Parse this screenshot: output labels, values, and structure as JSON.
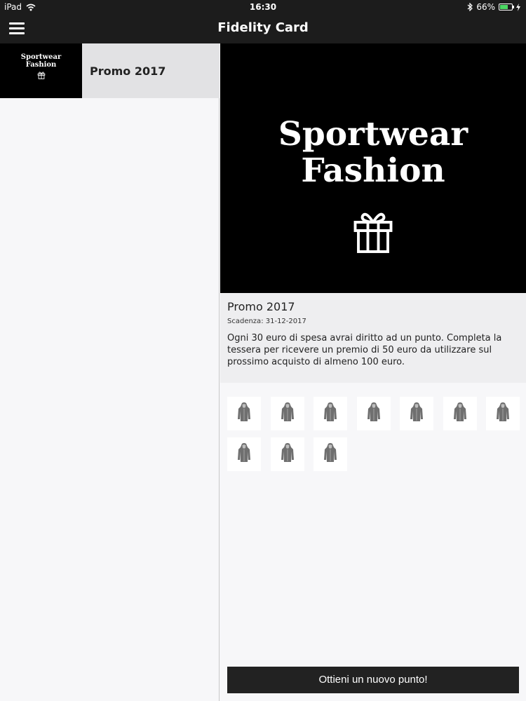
{
  "status_bar": {
    "device": "iPad",
    "time": "16:30",
    "battery_text": "66%",
    "battery_level": 0.66,
    "icons": [
      "wifi-icon",
      "bluetooth-icon",
      "battery-icon",
      "charging-icon"
    ]
  },
  "nav": {
    "title": "Fidelity Card",
    "menu_icon": "hamburger-menu-icon"
  },
  "list": {
    "items": [
      {
        "thumb_line1": "Sportwear",
        "thumb_line2": "Fashion",
        "thumb_icon": "gift-icon",
        "label": "Promo 2017"
      }
    ]
  },
  "detail": {
    "hero_line1": "Sportwear",
    "hero_line2": "Fashion",
    "hero_icon": "gift-icon",
    "title": "Promo 2017",
    "expiry": "Scadenza: 31-12-2017",
    "description": "Ogni 30 euro di spesa avrai diritto ad un punto. Completa la tessera per ricevere un premio di 50 euro da utilizzare sul prossimo acquisto di almeno 100 euro.",
    "stamp_icon": "hoodie-icon",
    "stamp_count": 10,
    "cta_label": "Ottieni un nuovo punto!"
  },
  "colors": {
    "bar_background": "#1c1c1c",
    "battery_green": "#4cd964",
    "button_background": "#222222"
  }
}
